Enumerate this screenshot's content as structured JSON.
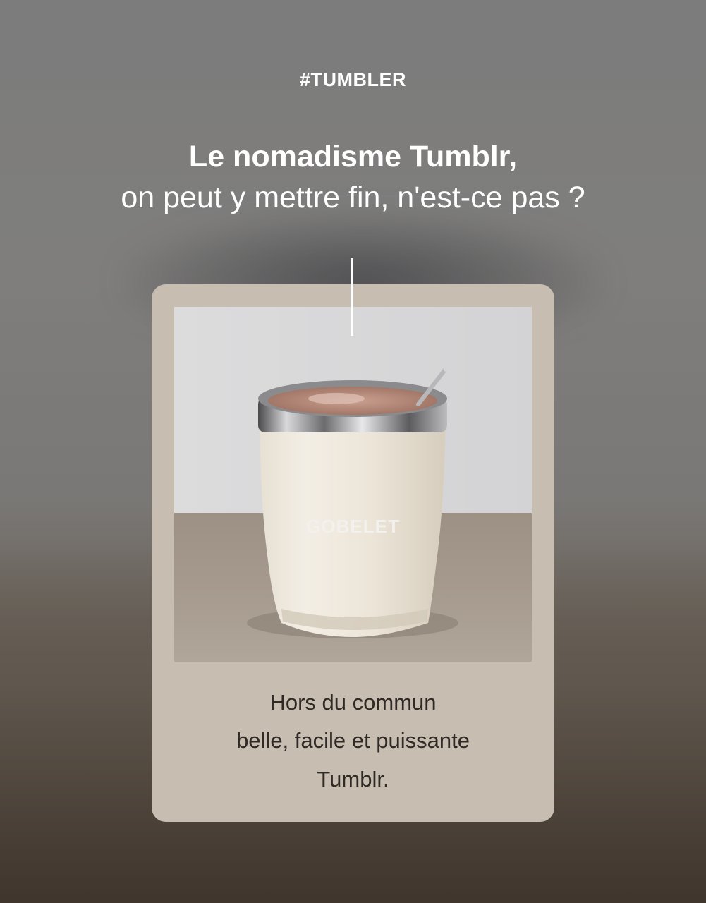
{
  "hashtag": "#TUMBLER",
  "headline": {
    "bold": "Le nomadisme Tumblr,",
    "regular": "on peut y mettre fin, n'est-ce pas ?"
  },
  "product": {
    "label": "GOBELET",
    "image_alt": "tumbler-photo"
  },
  "card": {
    "caption_lines": [
      "Hors du commun",
      "belle, facile et puissante",
      "Tumblr."
    ]
  },
  "colors": {
    "card_bg": "#c7beb1",
    "text_light": "#ffffff",
    "text_dark": "#2f2a25"
  }
}
